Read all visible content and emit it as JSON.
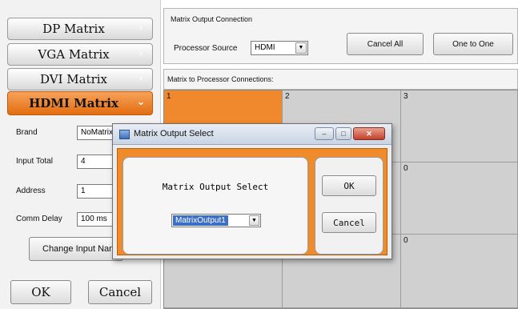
{
  "left_menu": {
    "items": [
      {
        "label": "DP Matrix"
      },
      {
        "label": "VGA Matrix"
      },
      {
        "label": "DVI Matrix"
      },
      {
        "label": "HDMI Matrix"
      }
    ],
    "active_index": 3
  },
  "settings": {
    "brand_label": "Brand",
    "brand_value": "NoMatrix",
    "input_total_label": "Input Total",
    "input_total_value": "4",
    "address_label": "Address",
    "address_value": "1",
    "comm_delay_label": "Comm Delay",
    "comm_delay_value": "100 ms",
    "change_input_button": "Change Input Name"
  },
  "footer": {
    "ok_label": "OK",
    "cancel_label": "Cancel"
  },
  "output_connection": {
    "title": "Matrix Output Connection",
    "processor_source_label": "Processor Source",
    "processor_source_value": "HDMI",
    "cancel_all_label": "Cancel All",
    "one_to_one_label": "One to One"
  },
  "connections": {
    "title": "Matrix to Processor Connections:",
    "cells": [
      {
        "label": "1",
        "selected": true
      },
      {
        "label": "2",
        "selected": false
      },
      {
        "label": "3",
        "selected": false
      },
      {
        "label": "",
        "selected": false
      },
      {
        "label": "",
        "selected": false
      },
      {
        "label": "0",
        "selected": false
      },
      {
        "label": "",
        "selected": false
      },
      {
        "label": "",
        "selected": false
      },
      {
        "label": "0",
        "selected": false
      }
    ]
  },
  "dialog": {
    "window_title": "Matrix Output Select",
    "heading": "Matrix Output Select",
    "select_value": "MatrixOutput1",
    "ok_label": "OK",
    "cancel_label": "Cancel",
    "minimize_glyph": "–",
    "maximize_glyph": "□",
    "close_glyph": "✕"
  },
  "colors": {
    "accent_orange": "#ef8b2a",
    "selection_blue": "#3a6fc4"
  }
}
